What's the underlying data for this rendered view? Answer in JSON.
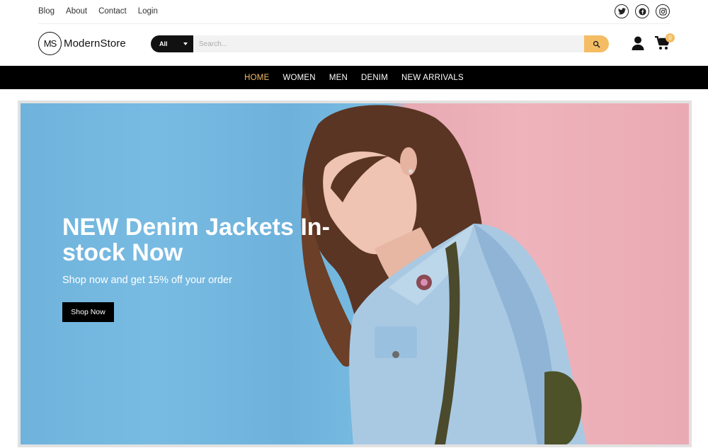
{
  "top_links": [
    "Blog",
    "About",
    "Contact",
    "Login"
  ],
  "socials": [
    "twitter-icon",
    "facebook-icon",
    "instagram-icon"
  ],
  "logo": {
    "mark": "MS",
    "name": "ModernStore"
  },
  "search": {
    "category": "All",
    "placeholder": "Search..."
  },
  "cart": {
    "count": "0"
  },
  "nav": {
    "items": [
      "HOME",
      "WOMEN",
      "MEN",
      "DENIM",
      "NEW ARRIVALS"
    ],
    "active": "HOME"
  },
  "hero": {
    "title": "NEW Denim Jackets In-stock Now",
    "subtitle": "Shop now and get 15% off your order",
    "button": "Shop Now"
  },
  "colors": {
    "accent": "#f4bd64",
    "nav_bg": "#000000",
    "hero_blue": "#74b8e0",
    "hero_pink": "#ecb0b8"
  }
}
